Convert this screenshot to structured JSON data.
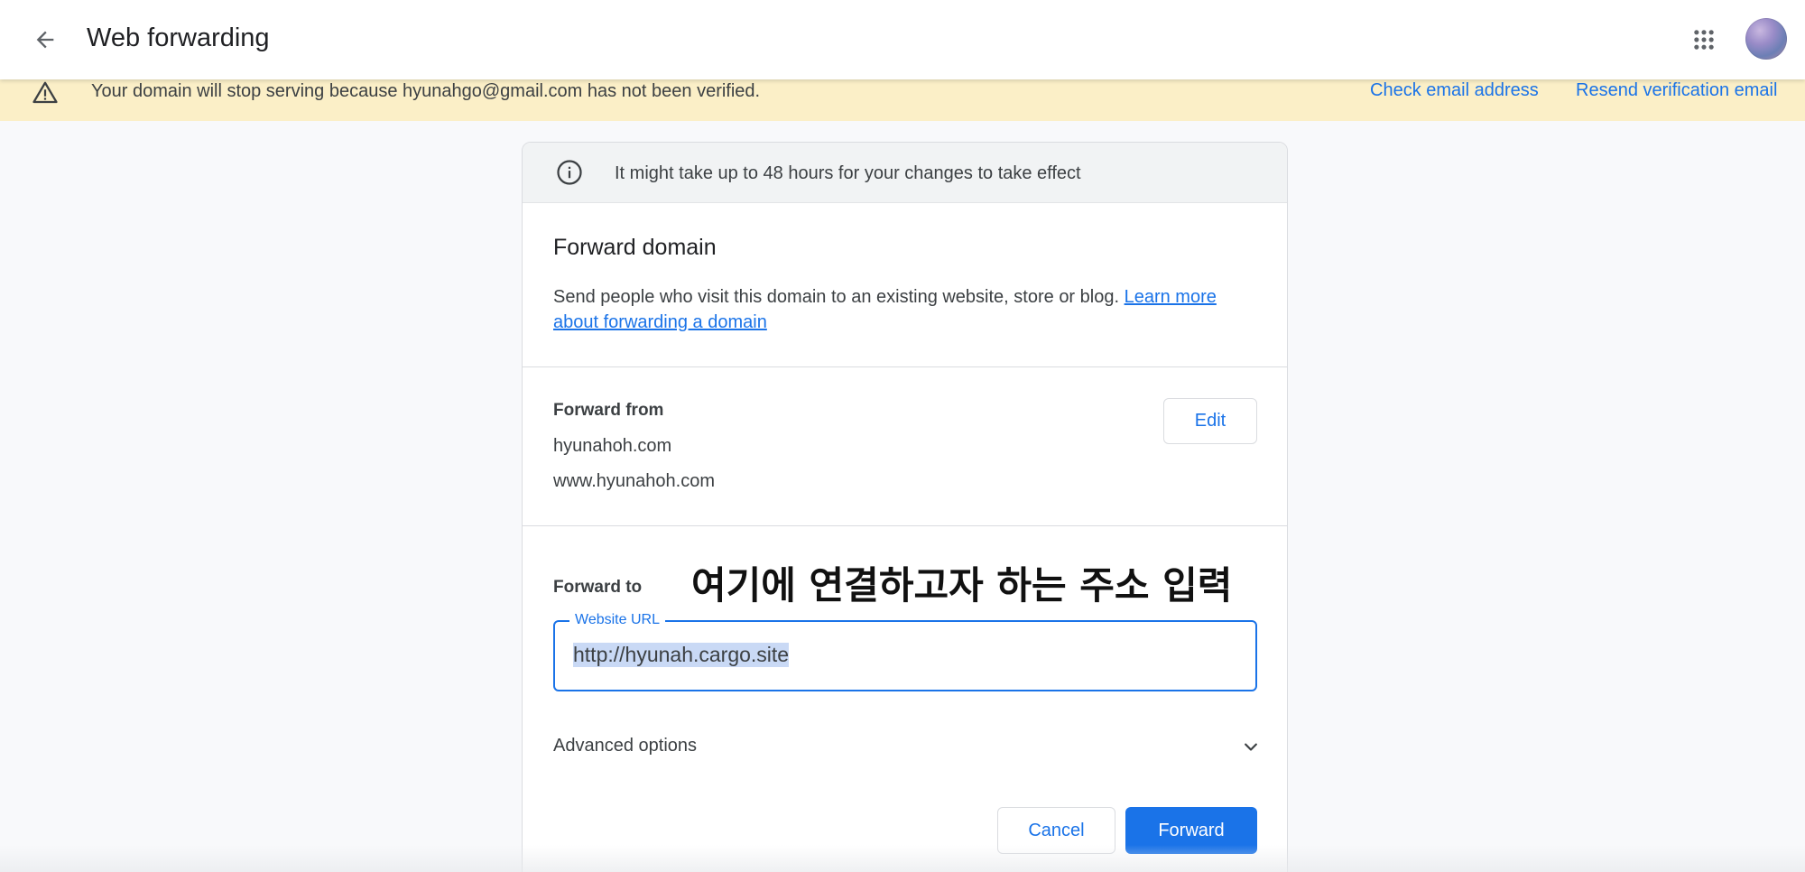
{
  "header": {
    "title": "Web forwarding",
    "back_icon": "arrow-back-icon",
    "apps_icon": "apps-grid-icon"
  },
  "banner": {
    "message": "Your domain will stop serving because hyunahgo@gmail.com has not been verified.",
    "check_email_link": "Check email address",
    "resend_link": "Resend verification email",
    "background": "#fbefc7",
    "icon": "warning-icon"
  },
  "info": {
    "message": "It might take up to 48 hours for your changes to take effect",
    "icon": "info-icon"
  },
  "forward_domain": {
    "title": "Forward domain",
    "description": "Send people who visit this domain to an existing website, store or blog. ",
    "learn_more": "Learn more about forwarding a domain"
  },
  "forward_from": {
    "label": "Forward from",
    "domains": [
      "hyunahoh.com",
      "www.hyunahoh.com"
    ],
    "edit_label": "Edit"
  },
  "forward_to": {
    "label": "Forward to",
    "annotation": "여기에 연결하고자 하는 주소 입력",
    "url_label": "Website URL",
    "url_value": "http://hyunah.cargo.site"
  },
  "advanced": {
    "label": "Advanced options",
    "icon": "chevron-down-icon"
  },
  "actions": {
    "cancel_label": "Cancel",
    "forward_label": "Forward"
  },
  "colors": {
    "accent": "#1a73e8",
    "page_bg": "#f8f9fb"
  }
}
